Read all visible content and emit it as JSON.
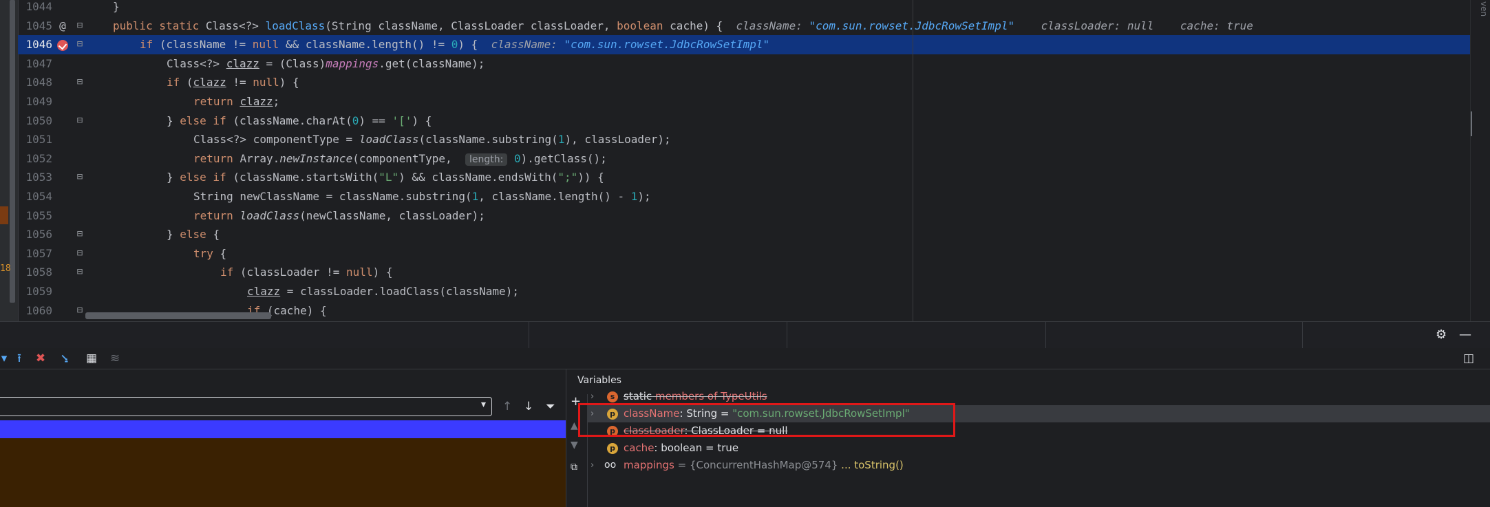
{
  "editor": {
    "lines": [
      {
        "num": "1044",
        "tokens": [
          {
            "t": "}",
            "c": "plain"
          }
        ],
        "indent": 0
      },
      {
        "num": "1045",
        "gutter": "@",
        "tokens": [
          {
            "t": "public static ",
            "c": "kw"
          },
          {
            "t": "Class<?> ",
            "c": "plain"
          },
          {
            "t": "loadClass",
            "c": "fn"
          },
          {
            "t": "(String className, ClassLoader classLoader, ",
            "c": "plain"
          },
          {
            "t": "boolean ",
            "c": "kw"
          },
          {
            "t": "cache) {  ",
            "c": "plain"
          },
          {
            "t": "className: ",
            "c": "hint"
          },
          {
            "t": "\"com.sun.rowset.JdbcRowSetImpl\"",
            "c": "hintval"
          },
          {
            "t": "    classLoader: null    cache: true",
            "c": "hint"
          }
        ],
        "indent": 0
      },
      {
        "num": "1046",
        "current": true,
        "breakpoint": true,
        "tokens": [
          {
            "t": "if ",
            "c": "kw"
          },
          {
            "t": "(className != ",
            "c": "plain"
          },
          {
            "t": "null ",
            "c": "kw"
          },
          {
            "t": "&& className.length() != ",
            "c": "plain"
          },
          {
            "t": "0",
            "c": "num"
          },
          {
            "t": ") {  ",
            "c": "plain"
          },
          {
            "t": "className: ",
            "c": "hint"
          },
          {
            "t": "\"com.sun.rowset.JdbcRowSetImpl\"",
            "c": "hintval"
          }
        ],
        "indent": 1
      },
      {
        "num": "1047",
        "tokens": [
          {
            "t": "Class<?> ",
            "c": "plain"
          },
          {
            "t": "clazz",
            "c": "u"
          },
          {
            "t": " = (Class)",
            "c": "plain"
          },
          {
            "t": "mappings",
            "c": "field"
          },
          {
            "t": ".get(className);",
            "c": "plain"
          }
        ],
        "indent": 2
      },
      {
        "num": "1048",
        "tokens": [
          {
            "t": "if ",
            "c": "kw"
          },
          {
            "t": "(",
            "c": "plain"
          },
          {
            "t": "clazz",
            "c": "u"
          },
          {
            "t": " != ",
            "c": "plain"
          },
          {
            "t": "null",
            "c": "kw"
          },
          {
            "t": ") {",
            "c": "plain"
          }
        ],
        "indent": 2
      },
      {
        "num": "1049",
        "tokens": [
          {
            "t": "return ",
            "c": "kw"
          },
          {
            "t": "clazz",
            "c": "u"
          },
          {
            "t": ";",
            "c": "plain"
          }
        ],
        "indent": 3
      },
      {
        "num": "1050",
        "tokens": [
          {
            "t": "} ",
            "c": "plain"
          },
          {
            "t": "else if ",
            "c": "kw"
          },
          {
            "t": "(className.charAt(",
            "c": "plain"
          },
          {
            "t": "0",
            "c": "num"
          },
          {
            "t": ") == ",
            "c": "plain"
          },
          {
            "t": "'['",
            "c": "str"
          },
          {
            "t": ") {",
            "c": "plain"
          }
        ],
        "indent": 2
      },
      {
        "num": "1051",
        "tokens": [
          {
            "t": "Class<?> componentType = ",
            "c": "plain"
          },
          {
            "t": "loadClass",
            "c": "it"
          },
          {
            "t": "(className.substring(",
            "c": "plain"
          },
          {
            "t": "1",
            "c": "num"
          },
          {
            "t": "), classLoader);",
            "c": "plain"
          }
        ],
        "indent": 3
      },
      {
        "num": "1052",
        "tokens": [
          {
            "t": "return ",
            "c": "kw"
          },
          {
            "t": "Array.",
            "c": "plain"
          },
          {
            "t": "newInstance",
            "c": "it"
          },
          {
            "t": "(componentType,  ",
            "c": "plain"
          },
          {
            "t": "length:",
            "c": "pill"
          },
          {
            "t": " ",
            "c": "plain"
          },
          {
            "t": "0",
            "c": "num"
          },
          {
            "t": ").getClass();",
            "c": "plain"
          }
        ],
        "indent": 3
      },
      {
        "num": "1053",
        "tokens": [
          {
            "t": "} ",
            "c": "plain"
          },
          {
            "t": "else if ",
            "c": "kw"
          },
          {
            "t": "(className.startsWith(",
            "c": "plain"
          },
          {
            "t": "\"L\"",
            "c": "str"
          },
          {
            "t": ") && className.endsWith(",
            "c": "plain"
          },
          {
            "t": "\";\"",
            "c": "str"
          },
          {
            "t": ")) {",
            "c": "plain"
          }
        ],
        "indent": 2
      },
      {
        "num": "1054",
        "tokens": [
          {
            "t": "String newClassName = className.substring(",
            "c": "plain"
          },
          {
            "t": "1",
            "c": "num"
          },
          {
            "t": ", className.length() - ",
            "c": "plain"
          },
          {
            "t": "1",
            "c": "num"
          },
          {
            "t": ");",
            "c": "plain"
          }
        ],
        "indent": 3
      },
      {
        "num": "1055",
        "tokens": [
          {
            "t": "return ",
            "c": "kw"
          },
          {
            "t": "loadClass",
            "c": "it"
          },
          {
            "t": "(newClassName, classLoader);",
            "c": "plain"
          }
        ],
        "indent": 3
      },
      {
        "num": "1056",
        "tokens": [
          {
            "t": "} ",
            "c": "plain"
          },
          {
            "t": "else ",
            "c": "kw"
          },
          {
            "t": "{",
            "c": "plain"
          }
        ],
        "indent": 2
      },
      {
        "num": "1057",
        "tokens": [
          {
            "t": "try ",
            "c": "kw"
          },
          {
            "t": "{",
            "c": "plain"
          }
        ],
        "indent": 3
      },
      {
        "num": "1058",
        "tokens": [
          {
            "t": "if ",
            "c": "kw"
          },
          {
            "t": "(classLoader != ",
            "c": "plain"
          },
          {
            "t": "null",
            "c": "kw"
          },
          {
            "t": ") {",
            "c": "plain"
          }
        ],
        "indent": 4
      },
      {
        "num": "1059",
        "tokens": [
          {
            "t": "clazz",
            "c": "u"
          },
          {
            "t": " = classLoader.loadClass(className);",
            "c": "plain"
          }
        ],
        "indent": 5
      },
      {
        "num": "1060",
        "tokens": [
          {
            "t": "if ",
            "c": "kw"
          },
          {
            "t": "(cache) {",
            "c": "plain"
          }
        ],
        "indent": 5
      }
    ],
    "fold_lines": [
      "1045",
      "1046",
      "1048",
      "1050",
      "1053",
      "1056",
      "1057",
      "1058",
      "1060"
    ]
  },
  "right_gutter": {
    "label": "ven"
  },
  "left_mark": "18",
  "toolbar": {
    "icons": [
      "step-over-icon",
      "step-out-icon",
      "clear-breakpoints-icon",
      "run-to-cursor-icon",
      "table-icon",
      "evaluate-icon"
    ]
  },
  "frames": {
    "selector_value": "",
    "dropdown_arrow": "▾"
  },
  "variables": {
    "title": "Variables",
    "rows": [
      {
        "name": "static",
        "rest": " members of TypeUtils",
        "badge": "s",
        "expandable": true,
        "struck": true
      },
      {
        "name": "className",
        "type": ": String",
        "eq": " = ",
        "value": "\"com.sun.rowset.JdbcRowSetImpl\"",
        "badge": "p",
        "expandable": true,
        "selected": true
      },
      {
        "name": "classLoader",
        "type": ": ClassLoader",
        "eq": " = ",
        "value": "null",
        "badge": "p",
        "expandable": false,
        "struck": true
      },
      {
        "name": "cache",
        "type": ": boolean",
        "eq": " = ",
        "value": "true",
        "badge": "p",
        "expandable": false
      },
      {
        "name": "mappings",
        "type": "",
        "eq": " = ",
        "value": "{ConcurrentHashMap@574}",
        "link": " ... toString()",
        "badge": "oo",
        "expandable": true
      }
    ]
  },
  "colors": {
    "accent": "#10347f",
    "highlight_box": "#e01818",
    "frame_bar": "#3b3bff"
  }
}
